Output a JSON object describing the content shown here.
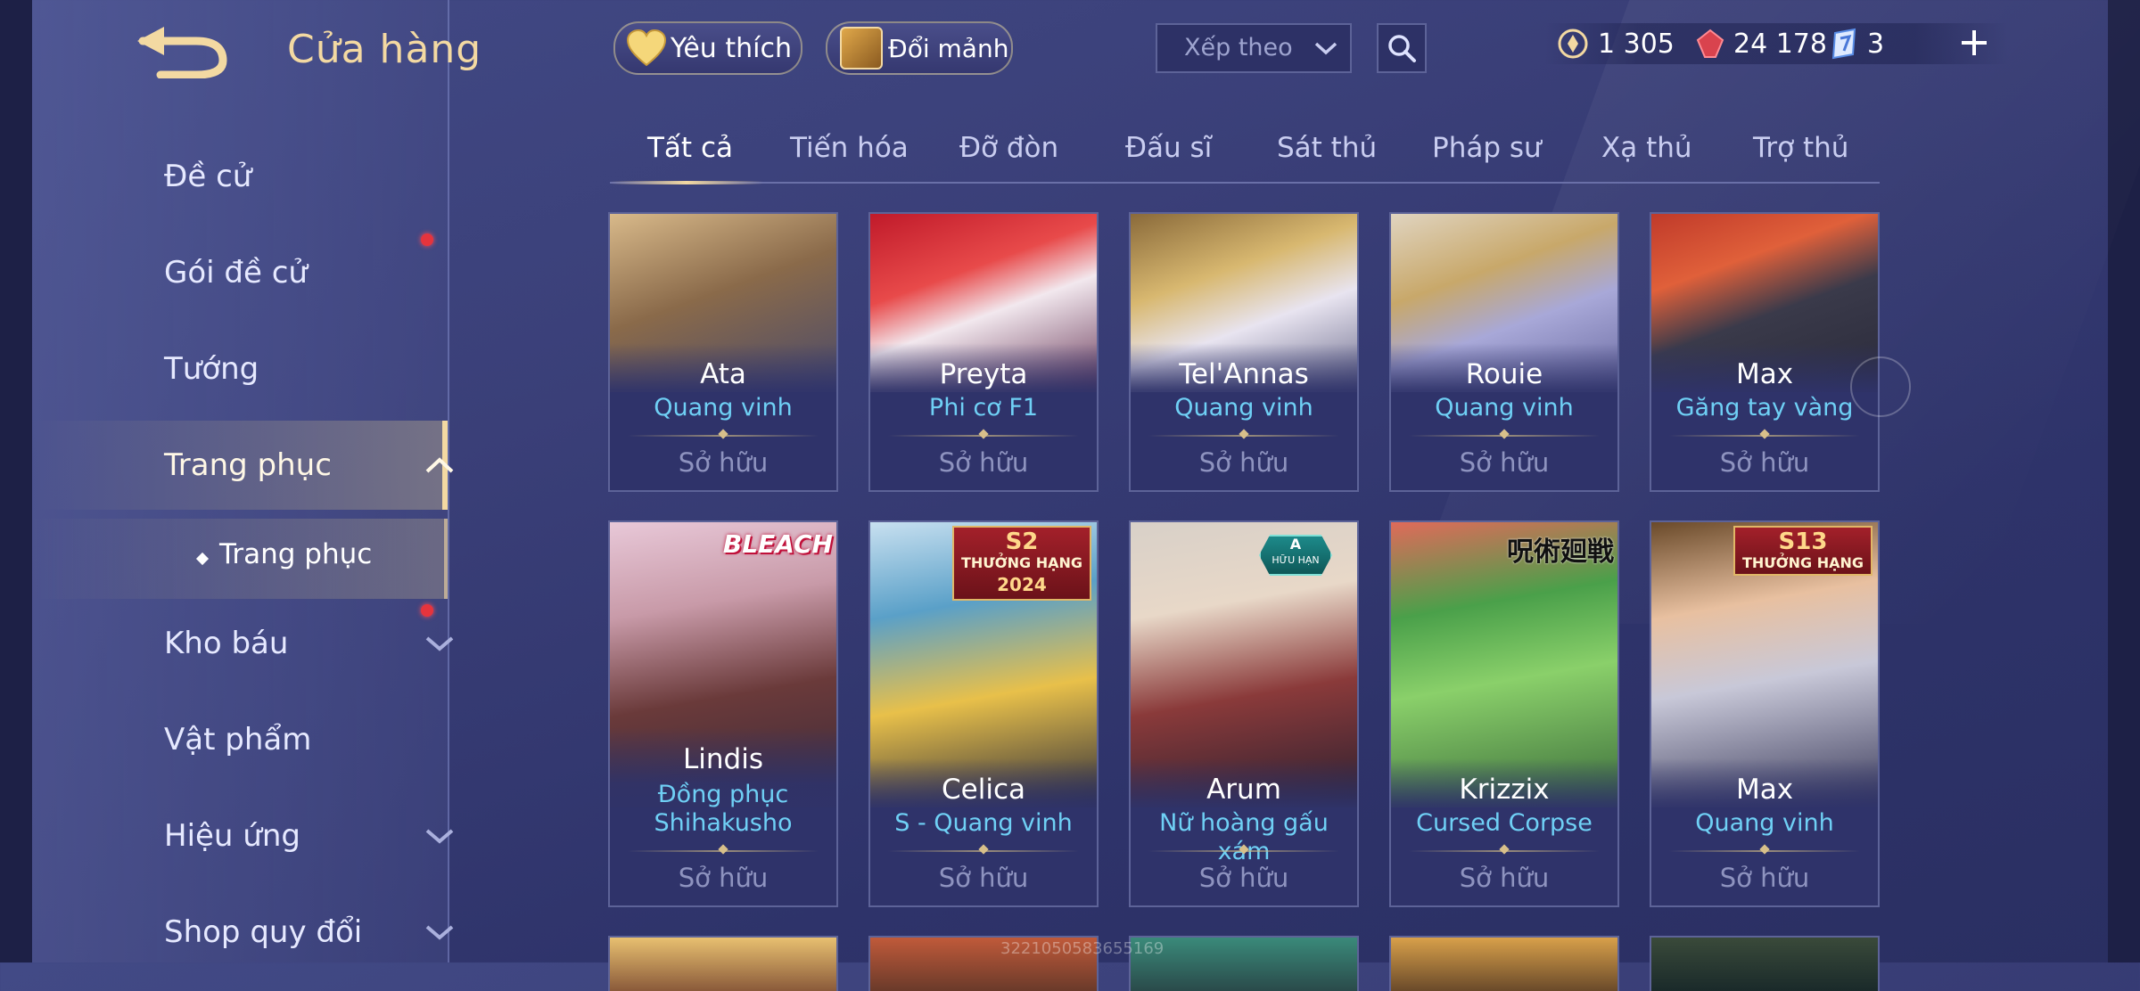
{
  "header": {
    "title": "Cửa hàng",
    "favorites_label": "Yêu thích",
    "exchange_label": "Đổi mảnh",
    "sort_label": "Xếp theo"
  },
  "currencies": [
    {
      "name": "voucher",
      "value": "1 305",
      "color": "#f3d9a2"
    },
    {
      "name": "gem",
      "value": "24 178",
      "color": "#e0505a"
    },
    {
      "name": "crystal",
      "value": "3",
      "color": "#6fb6ff"
    }
  ],
  "sidebar": {
    "items": [
      {
        "label": "Đề cử"
      },
      {
        "label": "Gói đề cử"
      },
      {
        "label": "Tướng"
      },
      {
        "label": "Trang phục"
      },
      {
        "label": "Kho báu"
      },
      {
        "label": "Vật phẩm"
      },
      {
        "label": "Hiệu ứng"
      },
      {
        "label": "Shop quy đổi"
      }
    ],
    "sub_item": "Trang phục"
  },
  "tabs": [
    "Tất cả",
    "Tiến hóa",
    "Đỡ đòn",
    "Đấu sĩ",
    "Sát thủ",
    "Pháp sư",
    "Xạ thủ",
    "Trợ thủ"
  ],
  "status_owned": "Sở hữu",
  "cards": [
    {
      "hero": "Ata",
      "skin": "Quang vinh"
    },
    {
      "hero": "Preyta",
      "skin": "Phi cơ F1"
    },
    {
      "hero": "Tel'Annas",
      "skin": "Quang vinh"
    },
    {
      "hero": "Rouie",
      "skin": "Quang vinh"
    },
    {
      "hero": "Max",
      "skin": "Găng tay vàng"
    },
    {
      "hero": "Lindis",
      "skin": "Đồng phục Shihakusho",
      "badge": "BLEACH"
    },
    {
      "hero": "Celica",
      "skin": "S - Quang vinh",
      "badge_big": "S2",
      "badge": "THƯỞNG HẠNG",
      "badge_year": "2024"
    },
    {
      "hero": "Arum",
      "skin": "Nữ hoàng gấu xám",
      "badge_a": "A",
      "badge": "HỮU HẠN"
    },
    {
      "hero": "Krizzix",
      "skin": "Cursed Corpse",
      "badge": "呪術廻戦"
    },
    {
      "hero": "Max",
      "skin": "Quang vinh",
      "badge_big": "S13",
      "badge": "THƯỞNG HẠNG"
    }
  ],
  "watermark": "3221050583655169",
  "colors": {
    "accent": "#f3d9a2",
    "skin_text": "#6fd0f5",
    "owned_text": "#8e93bf",
    "notify": "#e5343d"
  }
}
